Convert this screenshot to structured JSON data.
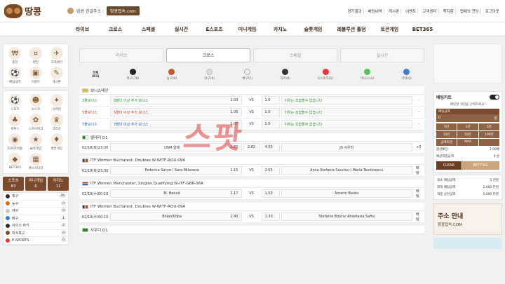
{
  "header": {
    "brand": "땅콩",
    "notice_text": "땅콩 한글주소 :",
    "notice_domain": "땅콩접속.com",
    "links": [
      "경기결과",
      "베팅내역",
      "게시판",
      "이벤트",
      "고객센터",
      "쪽지함",
      "캡페의 전당",
      "로그아웃"
    ]
  },
  "nav": [
    "라이브",
    "크로스",
    "스페셜",
    "실시간",
    "E스포츠",
    "미니게임",
    "카지노",
    "슬롯게임",
    "레볼루션 홀덤",
    "토큰게임",
    "BET365"
  ],
  "left": {
    "top_icons": [
      {
        "label": "충전",
        "glyph": "₩"
      },
      {
        "label": "환전",
        "glyph": "¤"
      },
      {
        "label": "고객센터",
        "glyph": "✈"
      },
      {
        "label": "배팅내역",
        "glyph": "⚽"
      },
      {
        "label": "이벤트",
        "glyph": "▣"
      },
      {
        "label": "게시판",
        "glyph": "✎"
      }
    ],
    "game_icons": [
      {
        "label": "스포츠",
        "glyph": "⚽"
      },
      {
        "label": "보스코",
        "glyph": "☻"
      },
      {
        "label": "슈퍼런",
        "glyph": "✦"
      },
      {
        "label": "로투스",
        "glyph": "♣"
      },
      {
        "label": "스카이파크",
        "glyph": "✿"
      },
      {
        "label": "크라운",
        "glyph": "♛"
      },
      {
        "label": "EOS파워볼",
        "glyph": "◉"
      },
      {
        "label": "슬롯게임",
        "glyph": "★"
      },
      {
        "label": "벳콘게임",
        "glyph": "♦"
      },
      {
        "label": "BET365",
        "glyph": "◆"
      },
      {
        "label": "큐브사다리",
        "glyph": "▦"
      }
    ],
    "tabs": [
      {
        "title": "스포츠",
        "count": "83"
      },
      {
        "title": "미니게임",
        "count": "6"
      },
      {
        "title": "카지노",
        "count": "11"
      }
    ],
    "sports": [
      {
        "name": "축구",
        "count": "76",
        "color": "#2d2d2d"
      },
      {
        "name": "농구",
        "count": "0",
        "color": "#d46a1a"
      },
      {
        "name": "야구",
        "count": "0",
        "color": "#c7c7c7"
      },
      {
        "name": "배구",
        "count": "1",
        "color": "#3a7bd5"
      },
      {
        "name": "아이스 하키",
        "count": "2",
        "color": "#2b2b2b"
      },
      {
        "name": "미식축구",
        "count": "0",
        "color": "#8b4a2b"
      },
      {
        "name": "E-SPORTS",
        "count": "0",
        "color": "#e53935"
      }
    ]
  },
  "center": {
    "tabs": [
      "라이브",
      "크로스",
      "스페셜",
      "실시간"
    ],
    "active_tab": 1,
    "sports_filter": [
      {
        "label": "전체\n(83)",
        "color": ""
      },
      {
        "label": "축구(76)",
        "color": "#222"
      },
      {
        "label": "농구(0)",
        "color": "#c0592b"
      },
      {
        "label": "야구(0)",
        "color": "#ccc"
      },
      {
        "label": "배구(1)",
        "color": "#ddd"
      },
      {
        "label": "하키(0)",
        "color": "#333"
      },
      {
        "label": "E스포츠(0)",
        "color": "#e33"
      },
      {
        "label": "미니스(4)",
        "color": "#55c055"
      },
      {
        "label": "기타(0)",
        "color": "#3a7bd5"
      }
    ],
    "sections": [
      {
        "title": "보너스배당",
        "flag": [
          "#e2b84b",
          "#e2b84b"
        ],
        "rows": [
          {
            "time": "3폴보너스",
            "home": "3폴더 이상 추가 보너스",
            "home_odds": "1.03",
            "draw": "VS",
            "away_odds": "1.0",
            "away": "이하는 조합할수 없습니다",
            "more": "-",
            "time_color": "#2a8a2a",
            "home_color": "#2a8a2a"
          },
          {
            "time": "5폴보너스",
            "home": "5폴더 이상 추가 보너스",
            "home_odds": "1.05",
            "draw": "VS",
            "away_odds": "1.0",
            "away": "이하는 조합할수 없습니다",
            "more": "-",
            "time_color": "#c0392b",
            "home_color": "#c0392b"
          },
          {
            "time": "7폴보너스",
            "home": "7폴더 이상 추가 보너스",
            "home_odds": "1.07",
            "draw": "VS",
            "away_odds": "1.0",
            "away": "이하는 조합할수 없습니다",
            "more": "-",
            "time_color": "#2456b3",
            "home_color": "#2456b3"
          }
        ]
      },
      {
        "title": "벨레리 D1",
        "flag": [
          "#c33",
          "#2a8a2a"
        ],
        "rows": [
          {
            "time": "02/18(화)23:30",
            "home": "USM 알제",
            "home_odds": "1.82",
            "draw": "2.82",
            "away_odds": "4.53",
            "away": "JS 사우라",
            "more": "+5"
          }
        ]
      },
      {
        "title": "ITF Women Bucharest, Doubles W-WITF-ROU-09A",
        "flag": [
          "#1a3a8a",
          "#e2c33a"
        ],
        "rows": [
          {
            "time": "02/18(화)23:30",
            "home": "Federica Sacco / Sara Milanese",
            "home_odds": "1.15",
            "draw": "VS",
            "away_odds": "2.55",
            "away": "Anca Stefania Sauciuc / Maria Teodorescu",
            "more": "배팅"
          }
        ]
      },
      {
        "title": "ITF Women Manchester, Singles Qualifying W-ITF-GBR-06A",
        "flag": [
          "#1a3a8a",
          "#c33"
        ],
        "rows": [
          {
            "time": "02/19(수)00:10",
            "home": "M. Benoit",
            "home_odds": "2.17",
            "draw": "VS",
            "away_odds": "1.53",
            "away": "Amarni Banks",
            "more": "배팅"
          }
        ]
      },
      {
        "title": "ITF Women Bucharest, Doubles W-WITF-ROU-09A",
        "flag": [
          "#1a3a8a",
          "#e2c33a"
        ],
        "rows": [
          {
            "time": "02/19(수)00:15",
            "home": "Bolan/Popa",
            "home_odds": "2.40",
            "draw": "VS",
            "away_odds": "1.30",
            "away": "Stefania Bojica/ Anastasia Safta",
            "more": "배팅"
          }
        ]
      },
      {
        "title": "사우디 D1",
        "flag": [
          "#2a8a2a",
          "#2a8a2a"
        ],
        "rows": []
      }
    ]
  },
  "right": {
    "cart_title": "배팅카트",
    "cart_message": "배팅할 게임을 선택하세요!",
    "amount_label": "배팅금액",
    "amount_value": "0",
    "amount_unit": "원",
    "chips": [
      "5만",
      "1만",
      "5천",
      "10만",
      "50만",
      "100만",
      "금액리셋",
      "MAX",
      ""
    ],
    "lines": [
      {
        "label": "합산배당",
        "value": "1.00배"
      },
      {
        "label": "예상적중금액",
        "value": "0 원"
      }
    ],
    "clear_label": "CLEAR",
    "bet_label": "BETTING",
    "limits": [
      {
        "label": "최소 배팅금액",
        "value": "5 천원"
      },
      {
        "label": "최대 배팅금액",
        "value": "2,000 만원"
      },
      {
        "label": "적중 상한금액",
        "value": "5,000 만원"
      }
    ],
    "promo_title": "주소 안내",
    "promo_url": "땅콩접속.COM"
  },
  "watermark": "스팟"
}
